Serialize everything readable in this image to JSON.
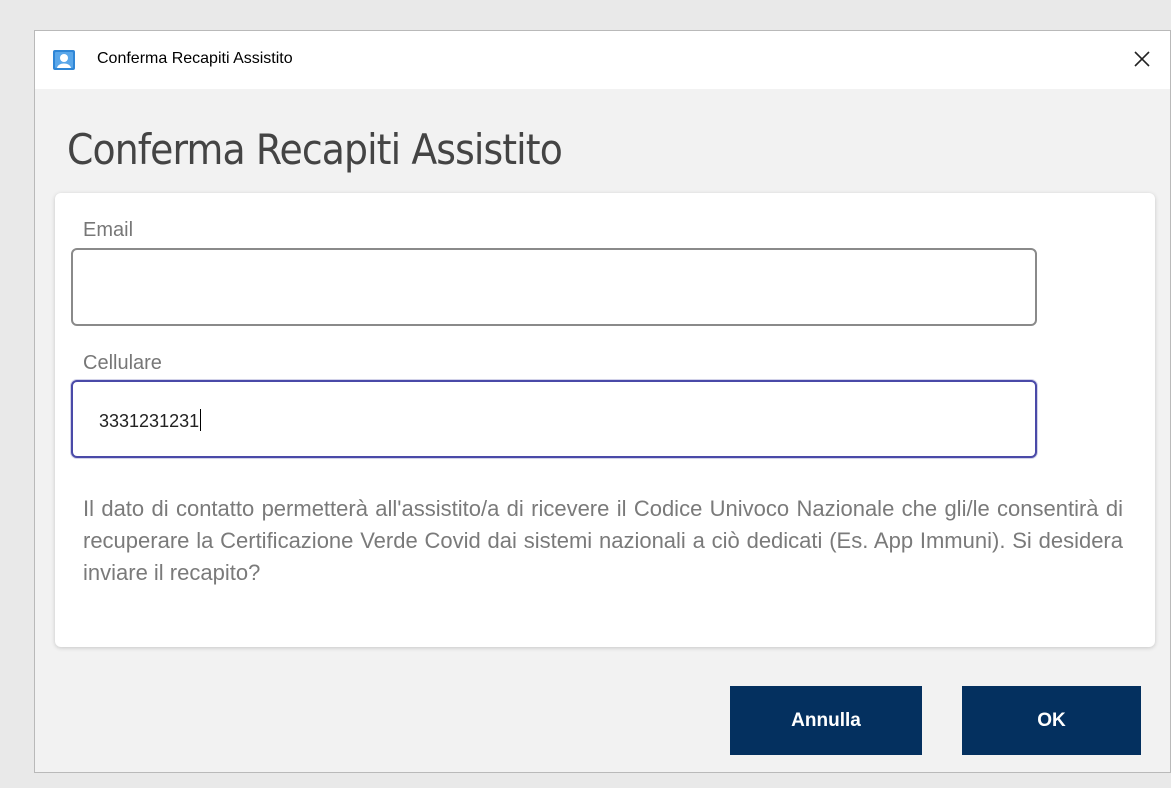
{
  "window": {
    "title": "Conferma Recapiti Assistito",
    "close_glyph": "×",
    "app_icon": "person-card-icon"
  },
  "dialog": {
    "heading": "Conferma Recapiti Assistito",
    "email": {
      "label": "Email",
      "value": ""
    },
    "cellulare": {
      "label": "Cellulare",
      "value": "3331231231"
    },
    "info_text": "Il dato di contatto permetterà all'assistito/a di ricevere il Codice Univoco Nazionale che gli/le consentirà di recuperare la Certificazione Verde Covid dai sistemi nazionali a ciò dedicati (Es. App Immuni). Si desidera inviare il recapito?"
  },
  "buttons": {
    "cancel": "Annulla",
    "ok": "OK"
  },
  "colors": {
    "button_bg": "#04305f",
    "focus_border": "#4a4aa8",
    "icon_blue": "#2f86d6"
  }
}
